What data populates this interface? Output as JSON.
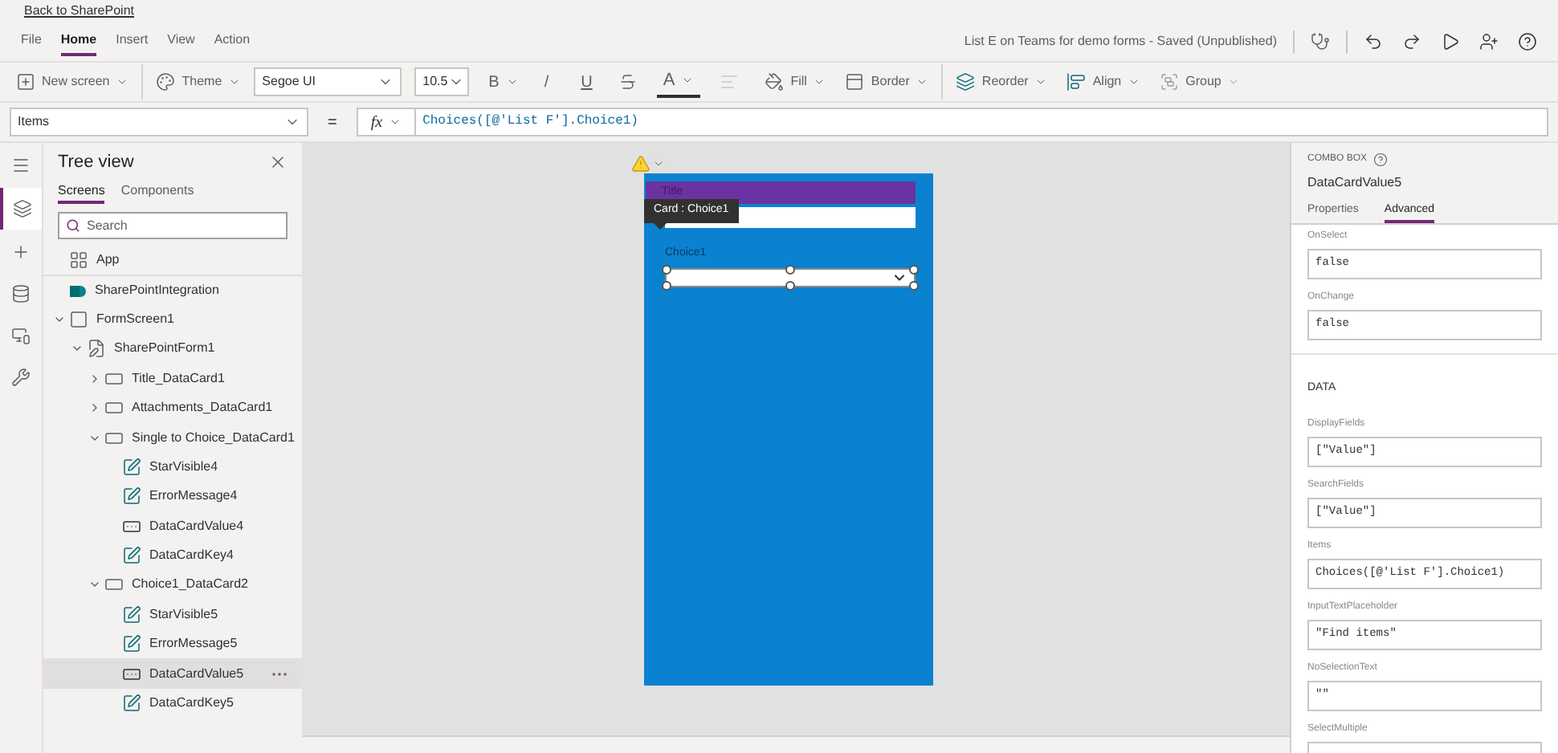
{
  "back_link": "Back to SharePoint",
  "menu": [
    {
      "label": "File",
      "selected": false
    },
    {
      "label": "Home",
      "selected": true
    },
    {
      "label": "Insert",
      "selected": false
    },
    {
      "label": "View",
      "selected": false
    },
    {
      "label": "Action",
      "selected": false
    }
  ],
  "app_title": "List E on Teams for demo forms - Saved (Unpublished)",
  "toolbar": {
    "new_screen": "New screen",
    "theme": "Theme",
    "font": "Segoe UI",
    "size": "10.5",
    "bold": "B",
    "italic": "/",
    "underline": "U",
    "font_color": "A",
    "fill": "Fill",
    "border": "Border",
    "reorder": "Reorder",
    "align": "Align",
    "group": {
      "label": "Group",
      "disabled": true
    }
  },
  "formula": {
    "property": "Items",
    "equals": "=",
    "fx": "fx",
    "expression": "Choices([@'List F'].Choice1)"
  },
  "tree": {
    "title": "Tree view",
    "tabs": [
      {
        "label": "Screens",
        "selected": true
      },
      {
        "label": "Components",
        "selected": false
      }
    ],
    "search_placeholder": "Search",
    "items": [
      {
        "label": "App",
        "kind": "app",
        "selected": false
      },
      {
        "label": "SharePointIntegration",
        "kind": "sharepoint",
        "selected": false
      },
      {
        "label": "FormScreen1",
        "kind": "screen",
        "selected": false,
        "expanded": true,
        "children": [
          {
            "label": "SharePointForm1",
            "kind": "form",
            "selected": false,
            "expanded": true,
            "children": [
              {
                "label": "Title_DataCard1",
                "kind": "card",
                "selected": false,
                "expanded": false
              },
              {
                "label": "Attachments_DataCard1",
                "kind": "card",
                "selected": false,
                "expanded": false
              },
              {
                "label": "Single to Choice_DataCard1",
                "kind": "card",
                "selected": false,
                "expanded": true,
                "children": [
                  {
                    "label": "StarVisible4",
                    "kind": "label",
                    "selected": false
                  },
                  {
                    "label": "ErrorMessage4",
                    "kind": "label",
                    "selected": false
                  },
                  {
                    "label": "DataCardValue4",
                    "kind": "combo",
                    "selected": false
                  },
                  {
                    "label": "DataCardKey4",
                    "kind": "label",
                    "selected": false
                  }
                ]
              },
              {
                "label": "Choice1_DataCard2",
                "kind": "card",
                "selected": false,
                "expanded": true,
                "children": [
                  {
                    "label": "StarVisible5",
                    "kind": "label",
                    "selected": false
                  },
                  {
                    "label": "ErrorMessage5",
                    "kind": "label",
                    "selected": false
                  },
                  {
                    "label": "DataCardValue5",
                    "kind": "combo",
                    "selected": true
                  },
                  {
                    "label": "DataCardKey5",
                    "kind": "label",
                    "selected": false
                  }
                ]
              }
            ]
          }
        ]
      }
    ]
  },
  "canvas": {
    "title_label": "Title",
    "tooltip": "Card : Choice1",
    "choice_label": "Choice1"
  },
  "properties": {
    "control_type": "COMBO BOX",
    "control_name": "DataCardValue5",
    "tabs": [
      {
        "label": "Properties",
        "selected": false
      },
      {
        "label": "Advanced",
        "selected": true
      }
    ],
    "items": [
      {
        "kind": "field",
        "label": "OnSelect",
        "value": "false"
      },
      {
        "kind": "field",
        "label": "OnChange",
        "value": "false"
      },
      {
        "kind": "section",
        "label": "DATA"
      },
      {
        "kind": "field",
        "label": "DisplayFields",
        "value": "[\"Value\"]"
      },
      {
        "kind": "field",
        "label": "SearchFields",
        "value": "[\"Value\"]"
      },
      {
        "kind": "field",
        "label": "Items",
        "value": "Choices([@'List F'].Choice1)"
      },
      {
        "kind": "field",
        "label": "InputTextPlaceholder",
        "value": "\"Find items\""
      },
      {
        "kind": "field",
        "label": "NoSelectionText",
        "value": "\"\""
      },
      {
        "kind": "field",
        "label": "SelectMultiple"
      }
    ]
  }
}
